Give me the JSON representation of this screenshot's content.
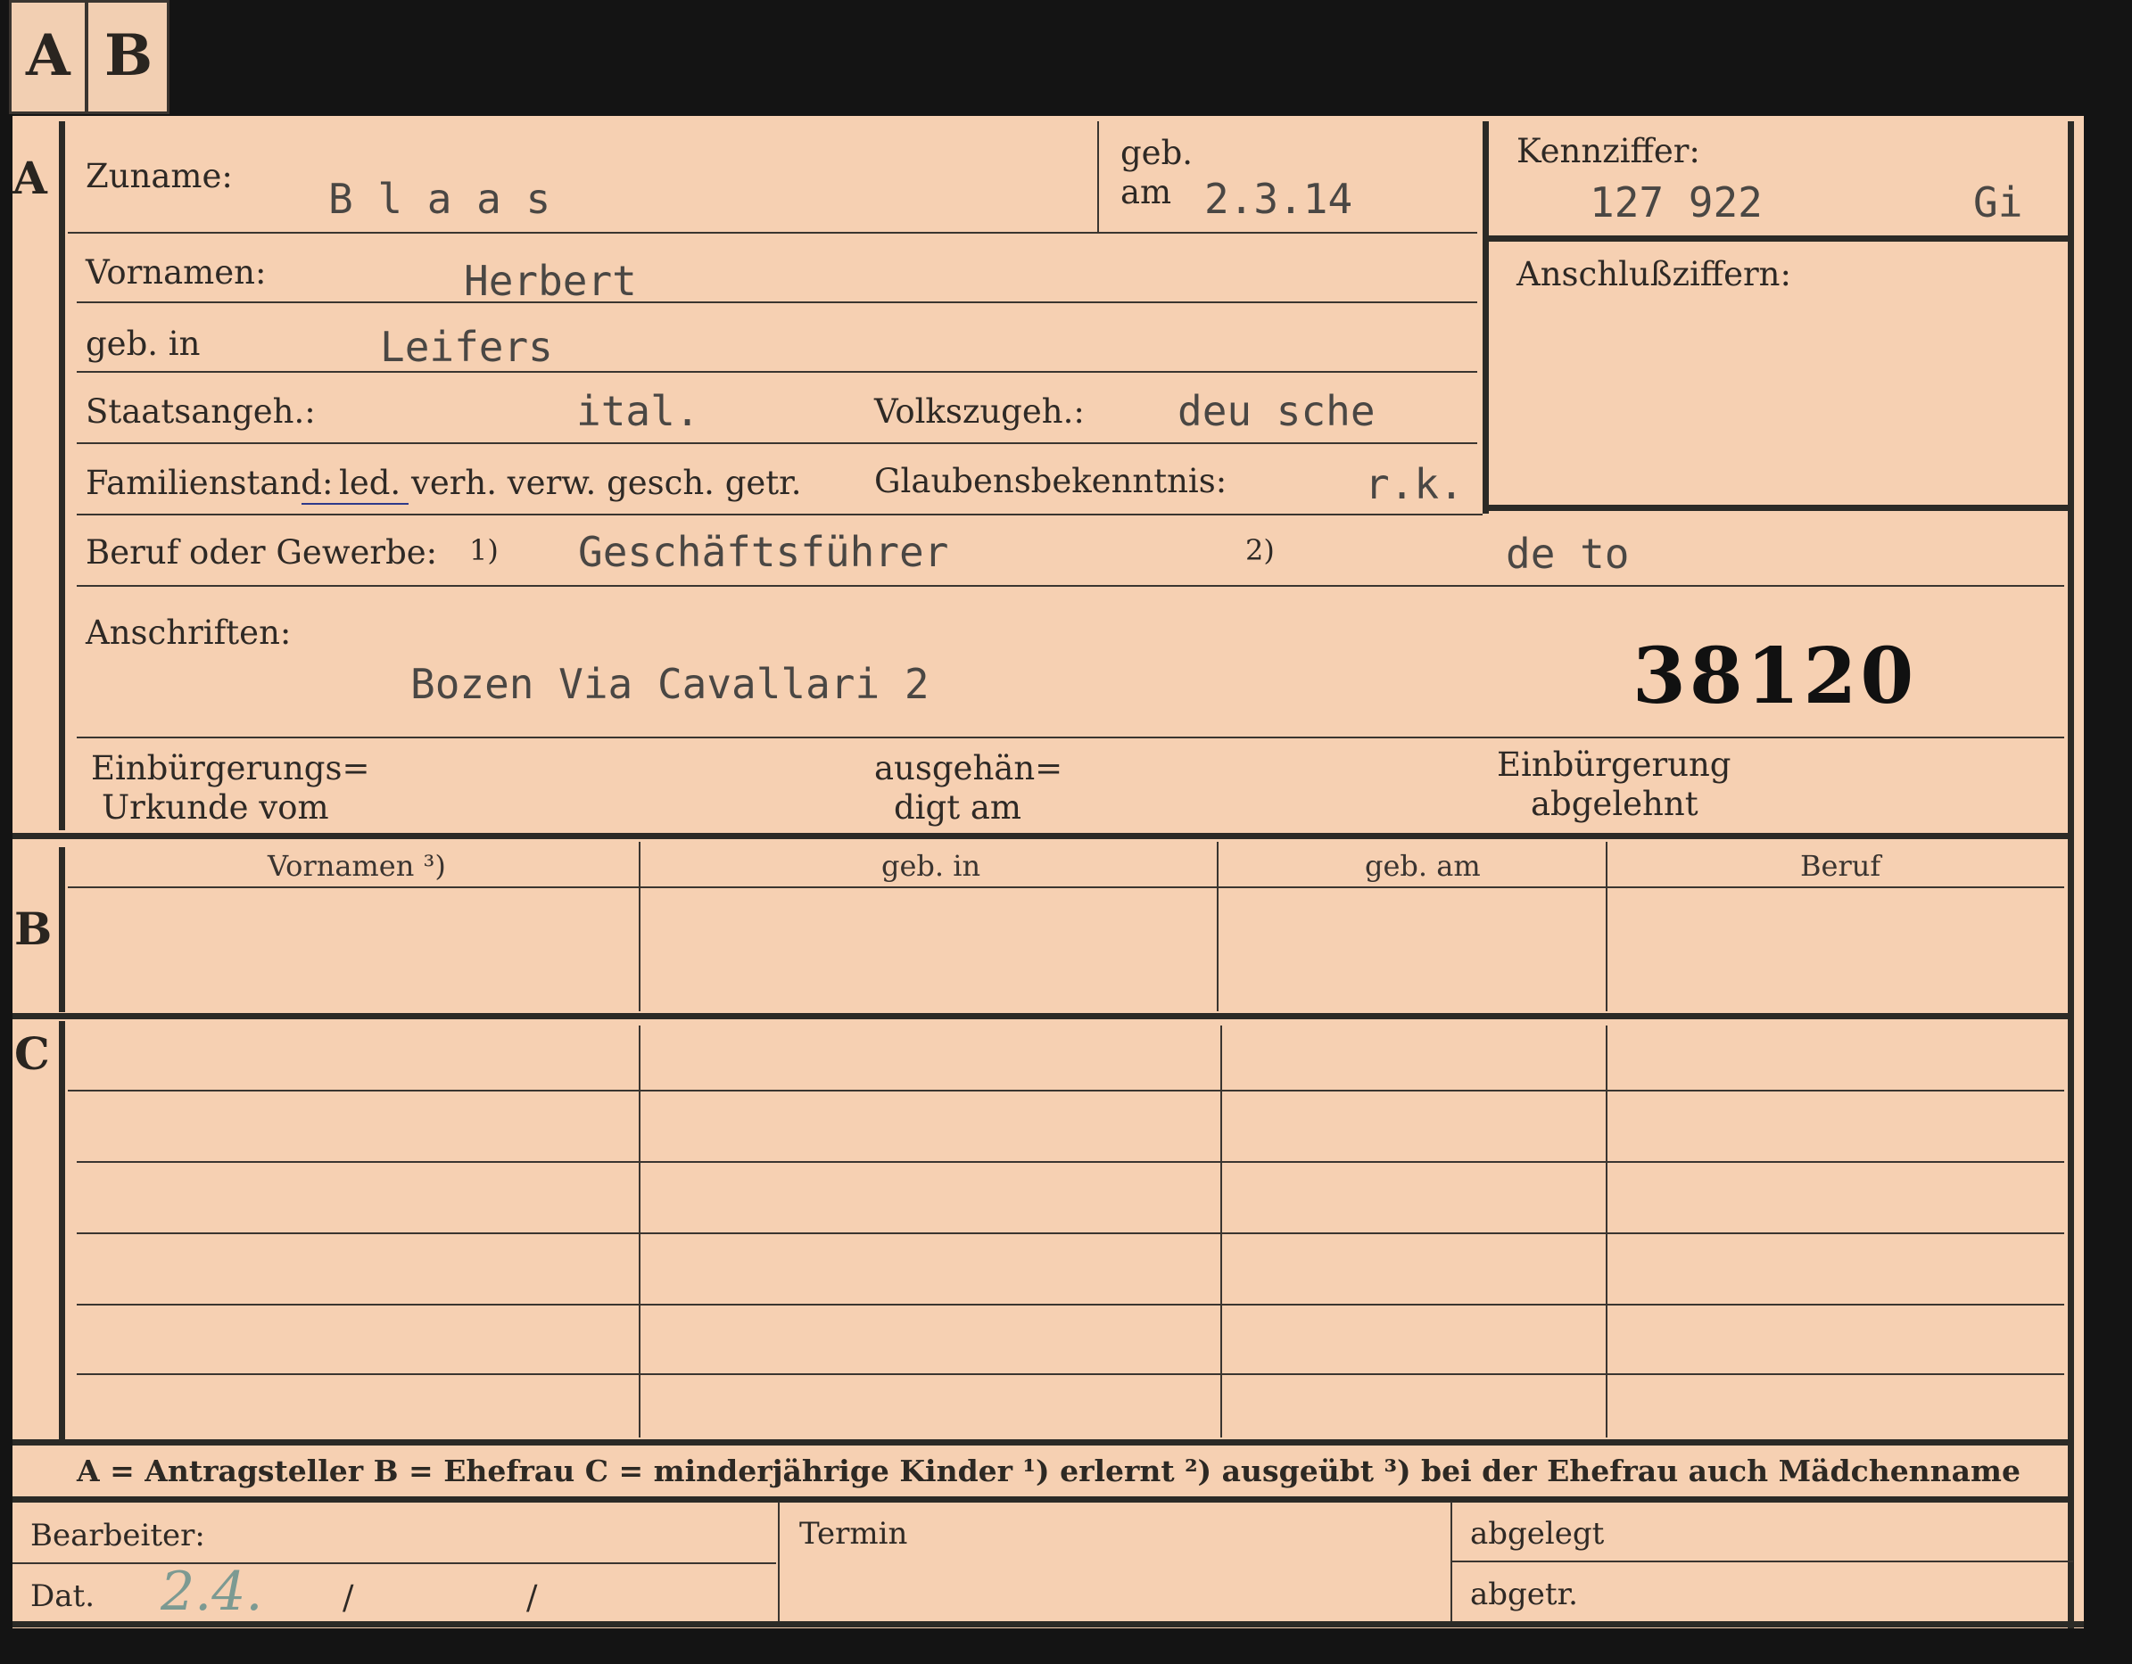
{
  "tabs": [
    "A",
    "B"
  ],
  "section_markers": {
    "a": "A",
    "b": "B",
    "c": "C"
  },
  "fields": {
    "surname_label": "Zuname:",
    "surname_value": "B l a a s",
    "born_label_1": "geb.",
    "born_label_2": "am",
    "born_date": "2.3.14",
    "id_label": "Kennziffer:",
    "id_number": "127 922",
    "id_suffix": "Gi",
    "link_numbers_label": "Anschlußziffern:",
    "first_names_label": "Vornamen:",
    "first_names_value": "Herbert",
    "birthplace_label": "geb. in",
    "birthplace_value": "Leifers",
    "citizenship_label": "Staatsangeh.:",
    "citizenship_value": "ital.",
    "ethnicity_label": "Volkszugeh.:",
    "ethnicity_value": "deu sche",
    "marital_label": "Familienstand:",
    "marital_options": "led.  verh.  verw.  gesch.  getr.",
    "religion_label": "Glaubensbekenntnis:",
    "religion_value": "r.k.",
    "occupation_label": "Beruf oder Gewerbe:",
    "occ_mark_1": "1)",
    "occupation_learned": "Geschäftsführer",
    "occ_mark_2": "2)",
    "occupation_practiced": "de to",
    "address_label": "Anschriften:",
    "address_value": "Bozen Via Cavallari 2",
    "file_number": "38120",
    "naturalization_cert_1": "Einbürgerungs=",
    "naturalization_cert_2": "Urkunde vom",
    "handed_out_1": "ausgehän=",
    "handed_out_2": "digt am",
    "naturalization_denied_1": "Einbürgerung",
    "naturalization_denied_2": "abgelehnt"
  },
  "table_headers": [
    "Vornamen ³)",
    "geb. in",
    "geb. am",
    "Beruf"
  ],
  "legend": "A = Antragsteller   B = Ehefrau   C = minderjährige Kinder   ¹) erlernt   ²) ausgeübt   ³) bei der Ehefrau auch Mädchenname",
  "footer": {
    "editor_label": "Bearbeiter:",
    "date_label": "Dat.",
    "date_handwritten": "2.4.",
    "slash_1": "/",
    "slash_2": "/",
    "deadline_label": "Termin",
    "filed_label": "abgelegt",
    "separated_label": "abgetr."
  }
}
